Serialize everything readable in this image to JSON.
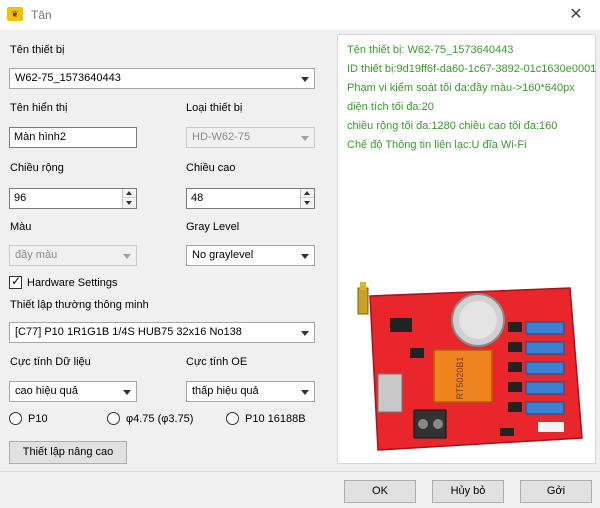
{
  "window": {
    "title": "Tăn",
    "icon_text": "❦"
  },
  "device_name": {
    "label": "Tên thiết bị",
    "value": "W62-75_1573640443"
  },
  "display_name": {
    "label": "Tên hiển thị",
    "value": "Màn hình2"
  },
  "device_type": {
    "label": "Loại thiết bị",
    "value": "HD-W62-75"
  },
  "width": {
    "label": "Chiều rộng",
    "value": "96"
  },
  "height": {
    "label": "Chiều cao",
    "value": "48"
  },
  "color": {
    "label": "Màu",
    "value": "đầy màu"
  },
  "gray_level": {
    "label": "Gray Level",
    "value": "No graylevel"
  },
  "hardware_settings": {
    "label": "Hardware Settings",
    "checked": true
  },
  "smart_setting": {
    "label": "Thiết lập thường thông minh",
    "value": "[C77]  P10  1R1G1B  1/4S HUB75  32x16  No138"
  },
  "data_polarity": {
    "label": "Cực tính Dữ liệu",
    "value": "cao hiệu quả"
  },
  "oe_polarity": {
    "label": "Cực tính OE",
    "value": "thấp hiệu quả"
  },
  "radios": [
    {
      "label": "P10"
    },
    {
      "label": "φ4.75 (φ3.75)"
    },
    {
      "label": "P10  16188B"
    }
  ],
  "advanced_button": "Thiết lập nâng cao",
  "info": {
    "lines": [
      "Tên thiết bị: W62-75_1573640443",
      "ID thiết bị:9d19ff6f-da60-1c67-3892-01c1630e0001",
      "Phạm vi kiểm soát tối đa:đầy màu->160*640px",
      "diện tích tối đa:20",
      "chiều rộng tối đa:1280 chiều cao tối đa:160",
      "Chế độ Thông tin liên lạc:U đĩa  Wi-Fi"
    ],
    "board_chip_text": "RT5020B1"
  },
  "footer": {
    "ok": "OK",
    "cancel": "Hủy bỏ",
    "send": "Gởi"
  }
}
